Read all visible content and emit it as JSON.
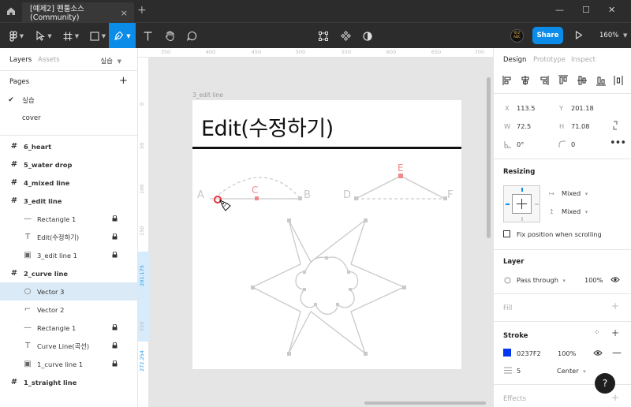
{
  "window": {
    "tab_title": "[예제2] 펜툴소스 (Community)",
    "tab_close": "×",
    "tab_add": "+",
    "minimize": "—",
    "maximize": "☐",
    "close": "✕"
  },
  "toolbar": {
    "avatar_text": "로모 ABC",
    "share_label": "Share",
    "zoom_label": "160%"
  },
  "left_panel": {
    "tab_layers": "Layers",
    "tab_assets": "Assets",
    "page_selector": "실습",
    "pages_heading": "Pages",
    "pages": [
      {
        "label": "실습",
        "current": true
      },
      {
        "label": "cover",
        "current": false
      }
    ],
    "layers": [
      {
        "label": "6_heart",
        "type": "frame",
        "indent": 0,
        "locked": false
      },
      {
        "label": "5_water drop",
        "type": "frame",
        "indent": 0,
        "locked": false
      },
      {
        "label": "4_mixed line",
        "type": "frame",
        "indent": 0,
        "locked": false
      },
      {
        "label": "3_edit line",
        "type": "frame",
        "indent": 0,
        "locked": false
      },
      {
        "label": "Rectangle 1",
        "type": "line",
        "indent": 1,
        "locked": true
      },
      {
        "label": "Edit(수정하기)",
        "type": "text",
        "indent": 1,
        "locked": true
      },
      {
        "label": "3_edit line 1",
        "type": "image",
        "indent": 1,
        "locked": true
      },
      {
        "label": "2_curve line",
        "type": "frame",
        "indent": 0,
        "locked": false
      },
      {
        "label": "Vector 3",
        "type": "vector-circle",
        "indent": 1,
        "locked": false,
        "selected": true
      },
      {
        "label": "Vector 2",
        "type": "vector",
        "indent": 1,
        "locked": false
      },
      {
        "label": "Rectangle 1",
        "type": "line",
        "indent": 1,
        "locked": true
      },
      {
        "label": "Curve Line(곡선)",
        "type": "text",
        "indent": 1,
        "locked": true
      },
      {
        "label": "1_curve line 1",
        "type": "image",
        "indent": 1,
        "locked": true
      },
      {
        "label": "1_straight line",
        "type": "frame",
        "indent": 0,
        "locked": false
      }
    ]
  },
  "rulers": {
    "top": [
      "350",
      "400",
      "450",
      "500",
      "550",
      "600",
      "650",
      "700"
    ],
    "left": [
      "0",
      "50",
      "100",
      "150",
      "201.175",
      "250",
      "272.254"
    ]
  },
  "canvas": {
    "frame_label": "3_edit line",
    "frame_title": "Edit(수정하기)",
    "point_labels": {
      "a": "A",
      "b": "B",
      "c": "C",
      "d": "D",
      "e": "E",
      "f": "F"
    }
  },
  "right_panel": {
    "tab_design": "Design",
    "tab_prototype": "Prototype",
    "tab_inspect": "Inspect",
    "x_label": "X",
    "x_value": "113.5",
    "y_label": "Y",
    "y_value": "201.18",
    "w_label": "W",
    "w_value": "72.5",
    "h_label": "H",
    "h_value": "71.08",
    "rotation": "0°",
    "corner_radius": "0",
    "resizing_heading": "Resizing",
    "resize_h": "Mixed",
    "resize_v": "Mixed",
    "fix_position_label": "Fix position when scrolling",
    "layer_heading": "Layer",
    "blend_mode": "Pass through",
    "layer_opacity": "100%",
    "fill_heading": "Fill",
    "stroke_heading": "Stroke",
    "stroke_color": "0237F2",
    "stroke_color_hex": "#0237f2",
    "stroke_opacity": "100%",
    "stroke_width": "5",
    "stroke_align": "Center",
    "effects_heading": "Effects",
    "help": "?"
  }
}
